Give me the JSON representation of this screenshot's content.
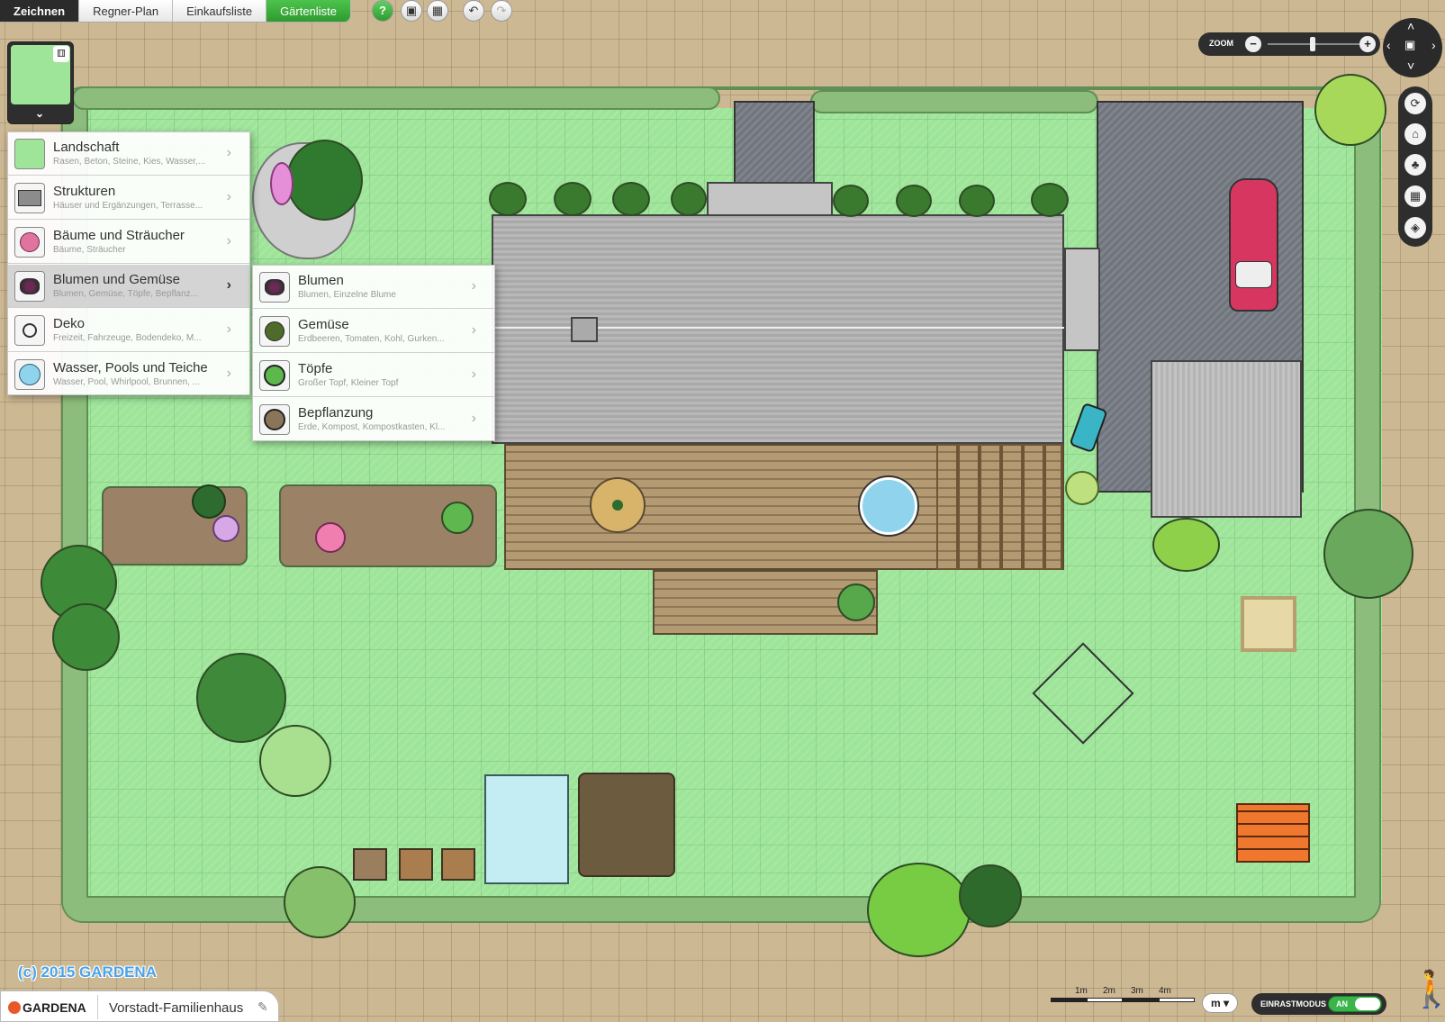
{
  "tabs": [
    {
      "label": "Zeichnen",
      "state": "active"
    },
    {
      "label": "Regner-Plan",
      "state": "normal"
    },
    {
      "label": "Einkaufsliste",
      "state": "normal"
    },
    {
      "label": "Gärtenliste",
      "state": "highlight"
    }
  ],
  "toolbar": {
    "help_icon": "question-mark-icon",
    "save_icon": "save-icon",
    "delete_icon": "trash-icon",
    "undo_icon": "undo-icon",
    "redo_icon": "redo-icon"
  },
  "menu": {
    "items": [
      {
        "title": "Landschaft",
        "subtitle": "Rasen, Beton, Steine, Kies, Wasser,...",
        "icon": "landscape-icon"
      },
      {
        "title": "Strukturen",
        "subtitle": "Häuser und Ergänzungen, Terrasse...",
        "icon": "structure-icon"
      },
      {
        "title": "Bäume und Sträucher",
        "subtitle": "Bäume, Sträucher",
        "icon": "tree-icon"
      },
      {
        "title": "Blumen und Gemüse",
        "subtitle": "Blumen, Gemüse, Töpfe, Bepflanz...",
        "icon": "flower-icon",
        "selected": true
      },
      {
        "title": "Deko",
        "subtitle": "Freizeit, Fahrzeuge, Bodendeko, M...",
        "icon": "deco-icon"
      },
      {
        "title": "Wasser, Pools und Teiche",
        "subtitle": "Wasser, Pool, Whirlpool, Brunnen, ...",
        "icon": "water-icon"
      }
    ]
  },
  "submenu": {
    "items": [
      {
        "title": "Blumen",
        "subtitle": "Blumen, Einzelne Blume",
        "icon": "flower-icon"
      },
      {
        "title": "Gemüse",
        "subtitle": "Erdbeeren, Tomaten, Kohl, Gurken...",
        "icon": "vegetable-icon"
      },
      {
        "title": "Töpfe",
        "subtitle": "Großer Topf, Kleiner Topf",
        "icon": "pot-icon"
      },
      {
        "title": "Bepflanzung",
        "subtitle": "Erde, Kompost, Kompostkasten, Kl...",
        "icon": "soil-icon"
      }
    ]
  },
  "zoom": {
    "label": "ZOOM",
    "minus": "−",
    "plus": "+",
    "level": 0.42
  },
  "side_tools": [
    "rotate-icon",
    "house-icon",
    "tree-icon",
    "grid-icon",
    "layers-icon"
  ],
  "footer": {
    "copyright": "(c) 2015 GARDENA",
    "brand": "GARDENA",
    "project_name": "Vorstadt-Familienhaus",
    "scale_labels": [
      "1m",
      "2m",
      "3m",
      "4m"
    ],
    "unit": "m",
    "snap_label": "EINRASTMODUS",
    "snap_state": "AN"
  },
  "colors": {
    "lawn": "#9ee59a",
    "hedge": "#8dbd7d",
    "ground": "#cdb894",
    "accent_green": "#3ab54a",
    "dark_ui": "#2e2e2e"
  }
}
